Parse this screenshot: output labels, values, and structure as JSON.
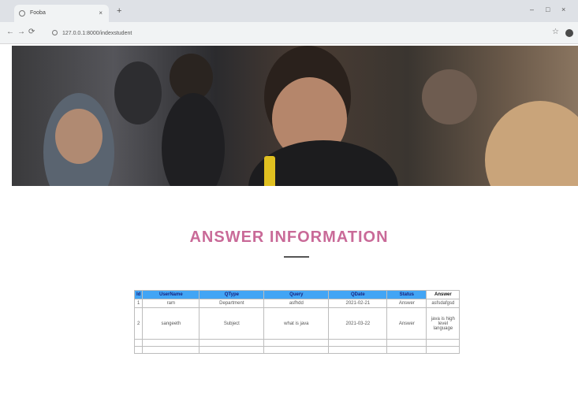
{
  "browser": {
    "tab_title": "Fooba",
    "tab_close": "×",
    "new_tab": "+",
    "url": "127.0.0.1:8000/indexstudent",
    "minimize": "–",
    "maximize": "□",
    "close": "×",
    "back": "←",
    "forward": "→",
    "reload": "⟳",
    "bookmark": "☆"
  },
  "page": {
    "section_title": "ANSWER INFORMATION",
    "colors": {
      "title": "#c96a98",
      "header_bg": "#42a5f5"
    }
  },
  "table": {
    "headers": [
      "Id",
      "UserName",
      "QType",
      "Query",
      "QDate",
      "Status",
      "Answer"
    ],
    "rows": [
      [
        "1",
        "ram",
        "Department",
        "asfhdd",
        "2021-02-21",
        "Answer",
        "asfsdafgsd"
      ],
      [
        "2",
        "sangeeth",
        "Subject",
        "what is java",
        "2021-03-22",
        "Answer",
        "java is high level language"
      ],
      [
        "",
        "",
        "",
        "",
        "",
        "",
        ""
      ],
      [
        "",
        "",
        "",
        "",
        "",
        "",
        ""
      ]
    ]
  }
}
